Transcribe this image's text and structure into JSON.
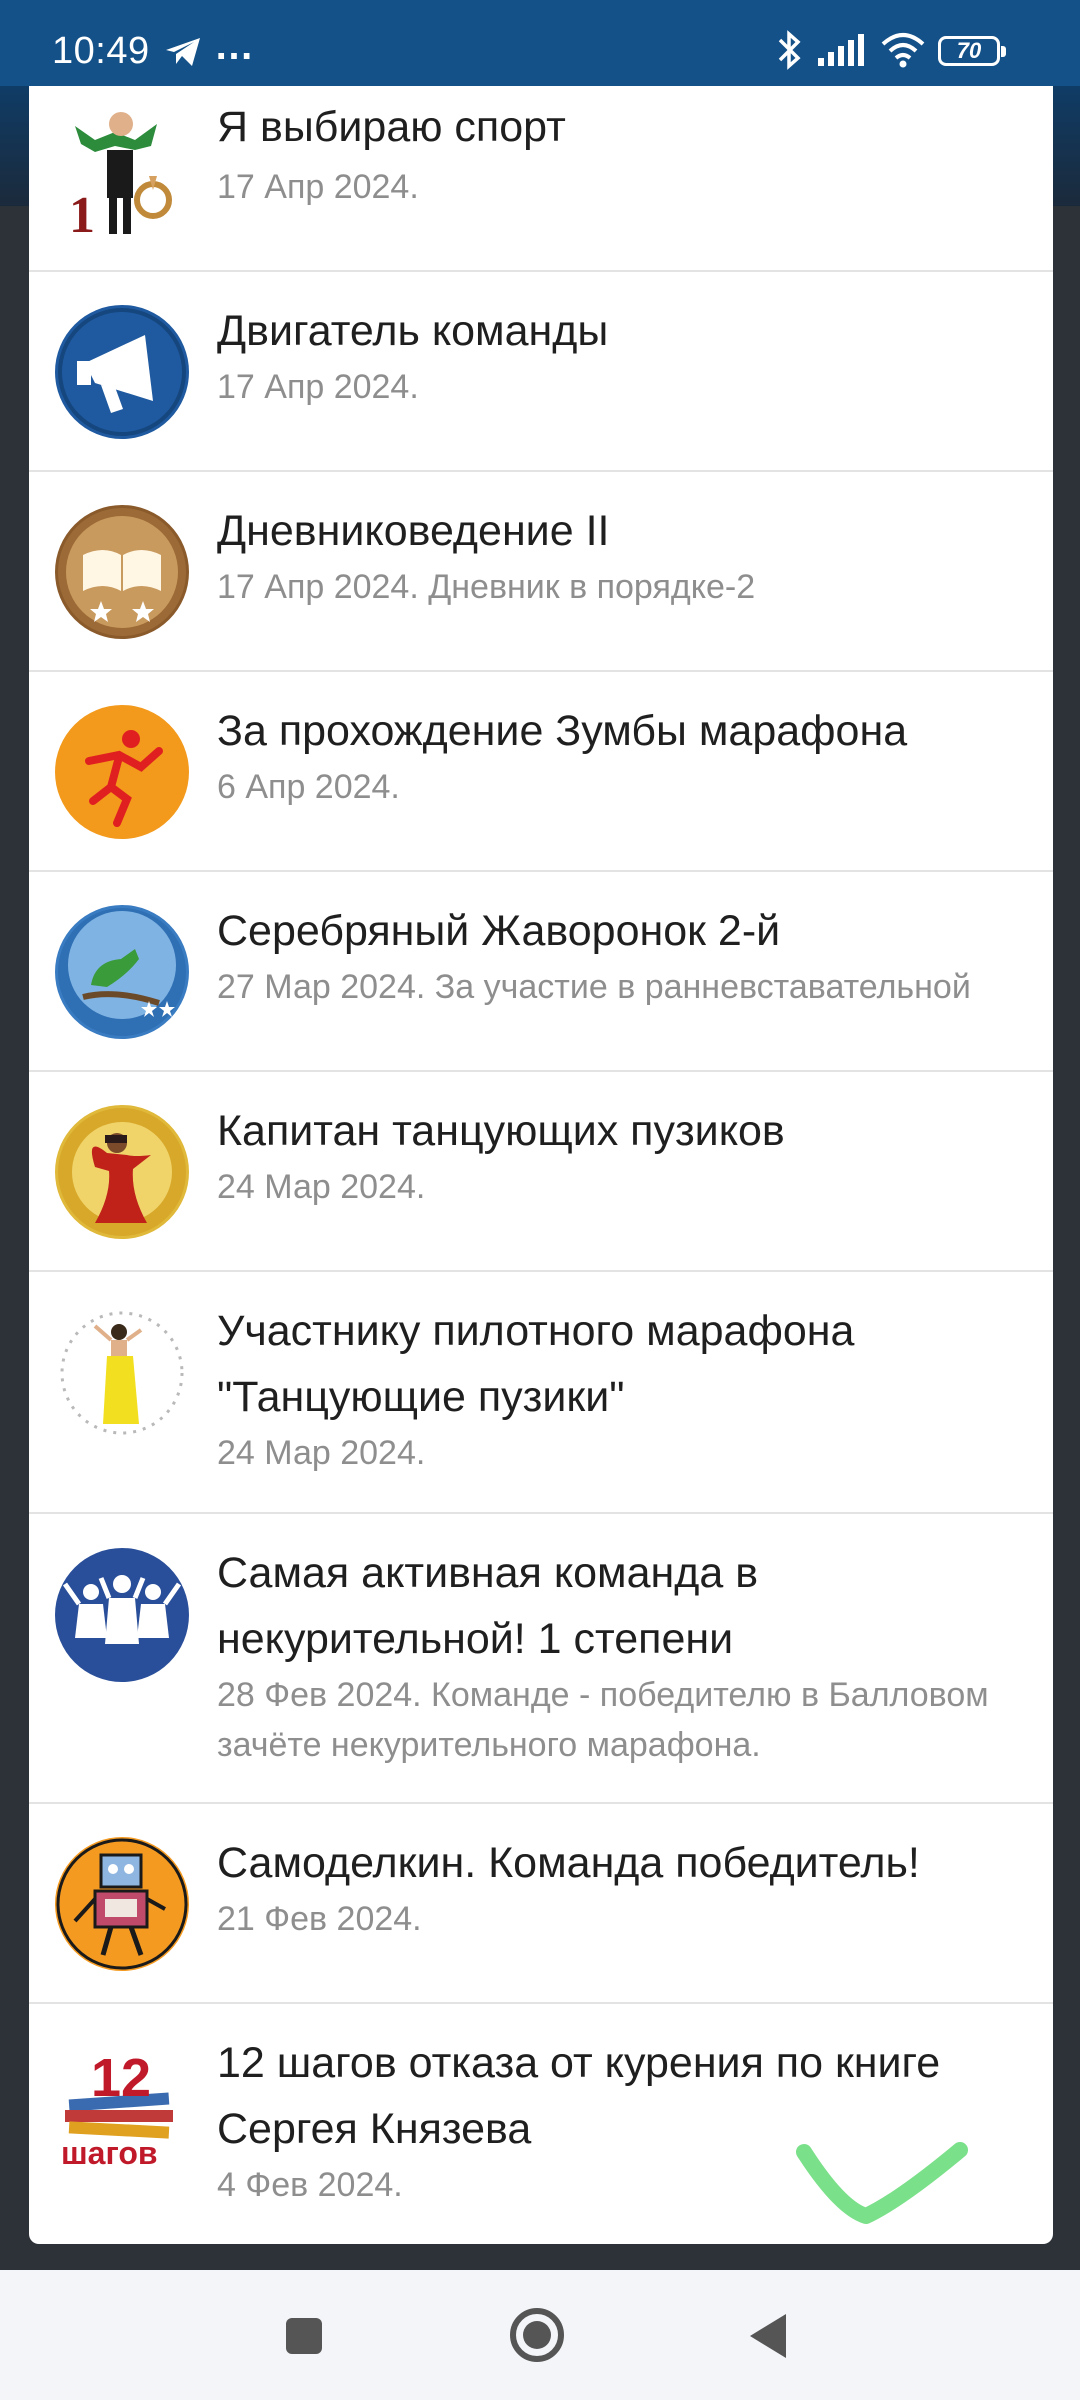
{
  "status_bar": {
    "time": "10:49",
    "more": "…",
    "battery": "70"
  },
  "awards": [
    {
      "title": "Я выбираю спорт",
      "meta": "17 Апр 2024.",
      "icon": "sport-mascot-icon"
    },
    {
      "title": "Двигатель команды",
      "meta": "17 Апр 2024.",
      "icon": "megaphone-icon"
    },
    {
      "title": "Дневниковедение II",
      "meta": "17 Апр 2024. Дневник в порядке-2",
      "icon": "book-stars-icon"
    },
    {
      "title": "За прохождение Зумбы марафона",
      "meta": "6 Апр 2024.",
      "icon": "zumba-icon"
    },
    {
      "title": "Серебряный Жаворонок 2-й",
      "meta": "27 Мар 2024. За участие в ранневставательной",
      "icon": "lark-icon"
    },
    {
      "title": "Капитан танцующих пузиков",
      "meta": "24 Мар 2024.",
      "icon": "dancer-gold-icon"
    },
    {
      "title": "Участнику пилотного марафона \"Танцующие пузики\"",
      "meta": "24 Мар 2024.",
      "icon": "dancer-icon"
    },
    {
      "title": "Самая активная команда в некурительной! 1 степени",
      "meta": "28 Фев 2024. Команде - победителю в Балловом зачёте некурительного марафона.",
      "icon": "team-icon"
    },
    {
      "title": "Самоделкин. Команда победитель!",
      "meta": "21 Фев 2024.",
      "icon": "robot-icon"
    },
    {
      "title": "12 шагов отказа от курения по книге Сергея Князева",
      "meta": "4 Фев 2024.",
      "icon": "books-12-steps-icon"
    }
  ],
  "badge_text": {
    "sport_number": "1",
    "steps_number": "12",
    "steps_word": "шагов"
  }
}
